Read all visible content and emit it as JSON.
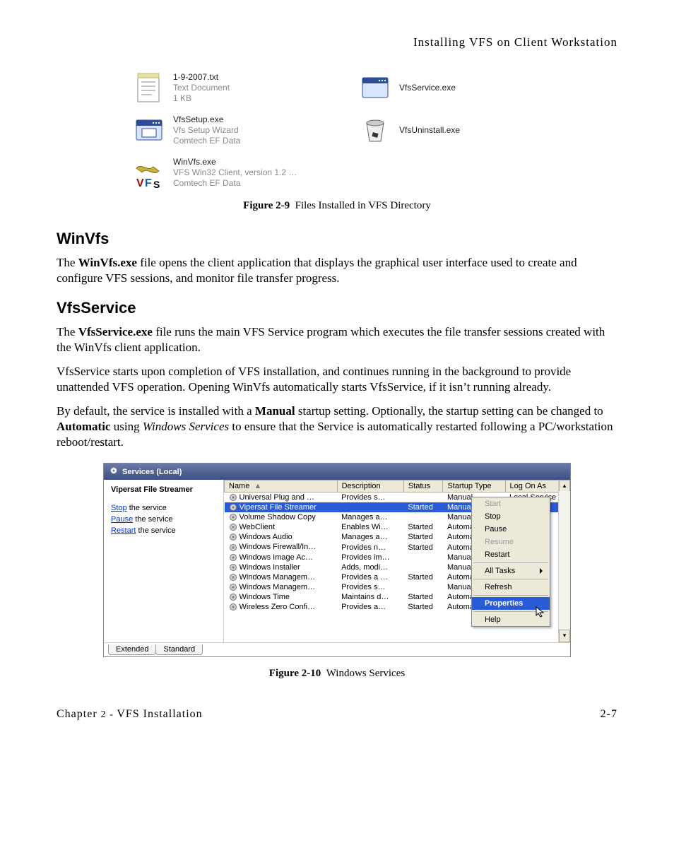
{
  "running_head": "Installing VFS on Client Workstation",
  "files": {
    "txt": {
      "name": "1-9-2007.txt",
      "l2": "Text Document",
      "l3": "1 KB"
    },
    "svc": {
      "name": "VfsService.exe"
    },
    "setup": {
      "name": "VfsSetup.exe",
      "l2": "Vfs Setup Wizard",
      "l3": "Comtech EF Data"
    },
    "unin": {
      "name": "VfsUninstall.exe"
    },
    "win": {
      "name": "WinVfs.exe",
      "l2": "VFS Win32 Client, version 1.2 …",
      "l3": "Comtech EF Data"
    }
  },
  "fig9": {
    "label": "Figure 2-9",
    "caption": "Files Installed in VFS Directory"
  },
  "h_winvfs": "WinVfs",
  "p_winvfs_a": "The ",
  "p_winvfs_b": "WinVfs.exe",
  "p_winvfs_c": " file opens the client application that displays the graphical user interface used to create and configure VFS sessions, and monitor file transfer progress.",
  "h_vfsservice": "VfsService",
  "p_svc1_a": "The ",
  "p_svc1_b": "VfsService.exe",
  "p_svc1_c": " file runs the main VFS Service program which executes the file transfer sessions created with the WinVfs client application.",
  "p_svc2": "VfsService starts upon completion of VFS installation, and continues running in the background to provide unattended VFS operation. Opening WinVfs automatically starts VfsService, if it isn’t running already.",
  "p_svc3_a": "By default, the service is installed with a ",
  "p_svc3_b": "Manual",
  "p_svc3_c": " startup setting. Optionally, the startup setting can be changed to ",
  "p_svc3_d": "Automatic",
  "p_svc3_e": " using ",
  "p_svc3_f": "Windows Services",
  "p_svc3_g": " to ensure that the Service is automatically restarted following a PC/workstation reboot/restart.",
  "services": {
    "title": "Services (Local)",
    "selected_name": "Vipersat File Streamer",
    "actions": {
      "stop_pre": "Stop",
      "stop_post": " the service",
      "pause_pre": "Pause",
      "pause_post": " the service",
      "restart_pre": "Restart",
      "restart_post": " the service"
    },
    "cols": {
      "name": "Name",
      "desc": "Description",
      "status": "Status",
      "startup": "Startup Type",
      "logon": "Log On As"
    },
    "rows": [
      {
        "n": "Universal Plug and …",
        "d": "Provides s…",
        "s": "",
        "t": "Manual",
        "l": "Local Service",
        "sel": false
      },
      {
        "n": "Vipersat File Streamer",
        "d": "",
        "s": "Started",
        "t": "Manual",
        "l": "",
        "sel": true
      },
      {
        "n": "Volume Shadow Copy",
        "d": "Manages a…",
        "s": "",
        "t": "Manual",
        "l": "",
        "sel": false
      },
      {
        "n": "WebClient",
        "d": "Enables Wi…",
        "s": "Started",
        "t": "Automatic",
        "l": "",
        "sel": false
      },
      {
        "n": "Windows Audio",
        "d": "Manages a…",
        "s": "Started",
        "t": "Automatic",
        "l": "",
        "sel": false
      },
      {
        "n": "Windows Firewall/In…",
        "d": "Provides n…",
        "s": "Started",
        "t": "Automatic",
        "l": "",
        "sel": false
      },
      {
        "n": "Windows Image Ac…",
        "d": "Provides im…",
        "s": "",
        "t": "Manual",
        "l": "",
        "sel": false
      },
      {
        "n": "Windows Installer",
        "d": "Adds, modi…",
        "s": "",
        "t": "Manual",
        "l": "",
        "sel": false
      },
      {
        "n": "Windows Managem…",
        "d": "Provides a …",
        "s": "Started",
        "t": "Automatic",
        "l": "",
        "sel": false
      },
      {
        "n": "Windows Managem…",
        "d": "Provides s…",
        "s": "",
        "t": "Manual",
        "l": "",
        "sel": false
      },
      {
        "n": "Windows Time",
        "d": "Maintains d…",
        "s": "Started",
        "t": "Automatic",
        "l": "",
        "sel": false
      },
      {
        "n": "Wireless Zero Confi…",
        "d": "Provides a…",
        "s": "Started",
        "t": "Automatic",
        "l": "",
        "sel": false
      }
    ],
    "context_menu": {
      "start": "Start",
      "stop": "Stop",
      "pause": "Pause",
      "resume": "Resume",
      "restart": "Restart",
      "all_tasks": "All Tasks",
      "refresh": "Refresh",
      "properties": "Properties",
      "help": "Help"
    },
    "tabs": {
      "extended": "Extended",
      "standard": "Standard"
    },
    "sort_indicator": "▲"
  },
  "fig10": {
    "label": "Figure 2-10",
    "caption": "Windows Services"
  },
  "footer": {
    "left_a": "Chapter ",
    "left_b": "2 - ",
    "left_c": "VFS Installation",
    "right": "2-7"
  }
}
